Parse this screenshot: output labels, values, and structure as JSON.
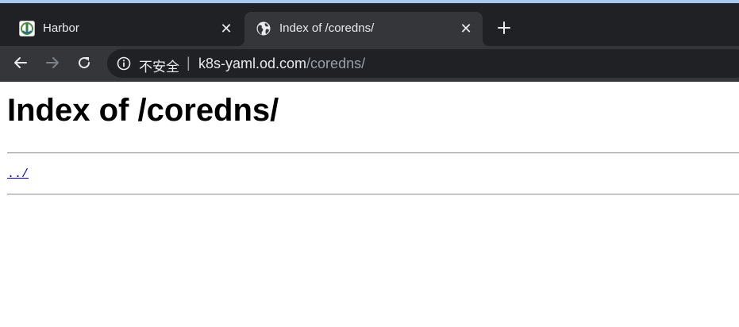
{
  "browser": {
    "tabs": [
      {
        "title": "Harbor",
        "active": false,
        "icon": "harbor-logo-icon",
        "close_label": "✕"
      },
      {
        "title": "Index of /coredns/",
        "active": true,
        "icon": "globe-icon",
        "close_label": "✕"
      }
    ],
    "new_tab_icon": "plus-icon",
    "toolbar": {
      "back_icon": "arrow-left-icon",
      "forward_icon": "arrow-right-icon",
      "reload_icon": "reload-icon"
    },
    "omnibox": {
      "security_icon": "info-circle-icon",
      "security_label": "不安全",
      "separator": "|",
      "url_host": "k8s-yaml.od.com",
      "url_path": "/coredns/"
    },
    "colors": {
      "chrome_bg": "#202124",
      "toolbar_bg": "#35363a",
      "text": "#e8eaed",
      "muted": "#9aa0a6",
      "link": "#0000ee"
    }
  },
  "page": {
    "heading": "Index of /coredns/",
    "entries": [
      {
        "name": "../"
      }
    ]
  }
}
